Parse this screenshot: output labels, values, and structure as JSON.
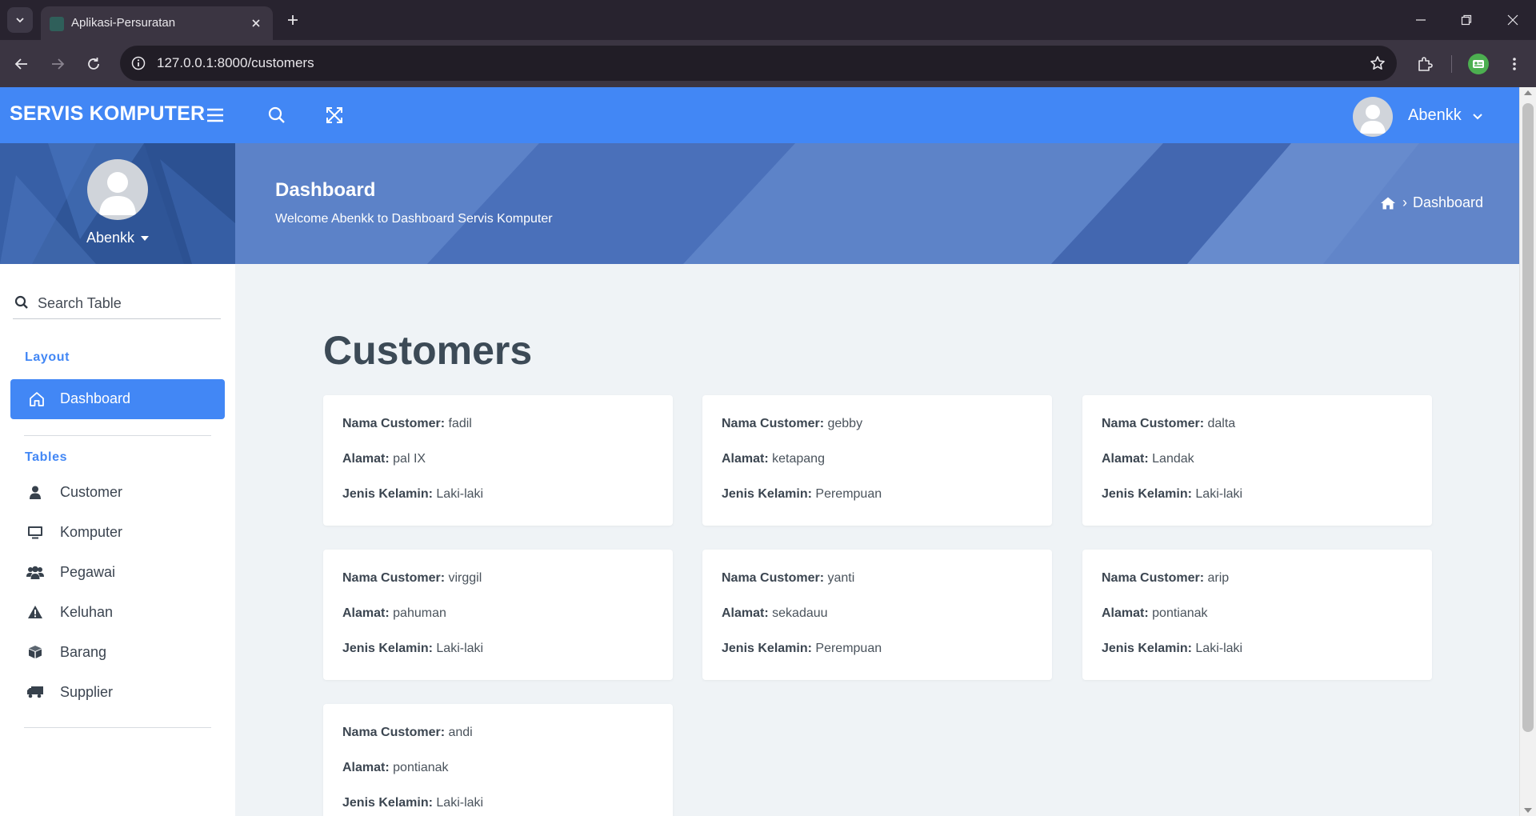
{
  "browser": {
    "tab_title": "Aplikasi-Persuratan",
    "url": "127.0.0.1:8000/customers"
  },
  "header": {
    "brand": "SERVIS KOMPUTER",
    "user_name": "Abenkk"
  },
  "sidebar": {
    "user_name": "Abenkk",
    "search_placeholder": "Search Table",
    "section_layout": "Layout",
    "active_item": "Dashboard",
    "section_tables": "Tables",
    "items": [
      {
        "label": "Customer",
        "icon": "user-icon"
      },
      {
        "label": "Komputer",
        "icon": "desktop-icon"
      },
      {
        "label": "Pegawai",
        "icon": "users-icon"
      },
      {
        "label": "Keluhan",
        "icon": "warning-icon"
      },
      {
        "label": "Barang",
        "icon": "box-icon"
      },
      {
        "label": "Supplier",
        "icon": "truck-icon"
      }
    ]
  },
  "banner": {
    "title": "Dashboard",
    "subtitle": "Welcome Abenkk to Dashboard Servis Komputer",
    "breadcrumb": "Dashboard"
  },
  "content": {
    "title": "Customers",
    "labels": {
      "name": "Nama Customer:",
      "address": "Alamat:",
      "gender": "Jenis Kelamin:"
    },
    "customers": [
      {
        "name": "fadil",
        "address": "pal IX",
        "gender": "Laki-laki"
      },
      {
        "name": "gebby",
        "address": "ketapang",
        "gender": "Perempuan"
      },
      {
        "name": "dalta",
        "address": "Landak",
        "gender": "Laki-laki"
      },
      {
        "name": "virggil",
        "address": "pahuman",
        "gender": "Laki-laki"
      },
      {
        "name": "yanti",
        "address": "sekadauu",
        "gender": "Perempuan"
      },
      {
        "name": "arip",
        "address": "pontianak",
        "gender": "Laki-laki"
      },
      {
        "name": "andi",
        "address": "pontianak",
        "gender": "Laki-laki"
      }
    ]
  },
  "colors": {
    "primary": "#4287f5",
    "sidebar_profile_bg": "#2f5597",
    "banner_bg": "#4d72bd",
    "content_bg": "#eff3f6"
  }
}
